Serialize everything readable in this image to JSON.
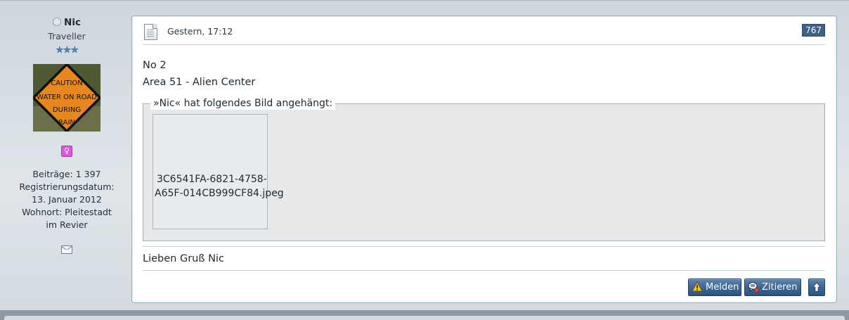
{
  "author": {
    "username": "Nic",
    "rank": "Traveller",
    "rank_stars": 3,
    "gender_symbol": "♀",
    "stats": {
      "posts": "Beiträge: 1 397",
      "registered_label": "Registrierungsdatum:",
      "registered_date": "13. Januar 2012",
      "location_label": "Wohnort: Pleitestadt",
      "location_cont": "im Revier"
    },
    "avatar_sign": [
      "CAUTION",
      "WATER ON ROAD",
      "DURING",
      "RAIN"
    ]
  },
  "post": {
    "date": "Gestern, 17:12",
    "number": "767",
    "lines": [
      "No 2",
      "Area 51 - Alien Center"
    ],
    "attachment_legend": "»Nic« hat folgendes Bild angehängt:",
    "attachment_filename_1": "3C6541FA-6821-4758-",
    "attachment_filename_2": "A65F-014CB999CF84.jpeg",
    "signature": "Lieben Gruß Nic"
  },
  "buttons": {
    "report": "Melden",
    "quote": "Zitieren"
  },
  "colors": {
    "accent": "#3d6289",
    "gender": "#d65bd6",
    "background": "#8e9aa3"
  }
}
